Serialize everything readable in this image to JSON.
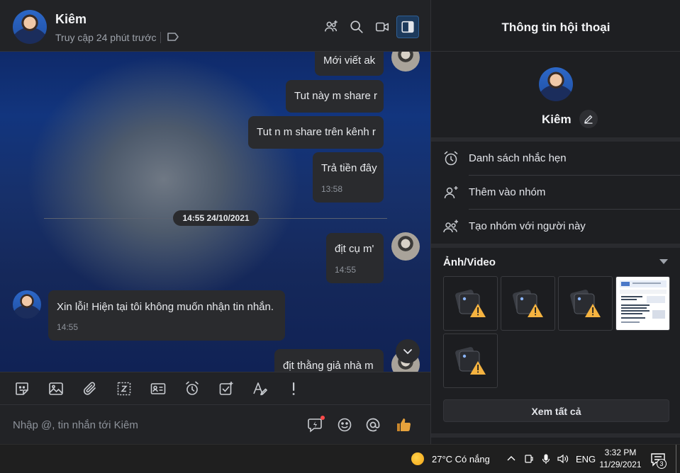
{
  "header": {
    "contact_name": "Kiêm",
    "status": "Truy cập 24 phút trước"
  },
  "messages": {
    "m1": "Mới viết ak",
    "m2": "Tut này m share r",
    "m3": "Tut n m share trên kênh r",
    "m4": "Trả tiền đây",
    "m4_time": "13:58",
    "date_divider": "14:55 24/10/2021",
    "m5": "địt cụ m'",
    "m5_time": "14:55",
    "m6": "Xin lỗi! Hiện tại tôi không muốn nhận tin nhắn.",
    "m6_time": "14:55",
    "m7": "địt thằng giả nhà m"
  },
  "composer": {
    "placeholder": "Nhập @, tin nhắn tới Kiêm"
  },
  "info": {
    "title": "Thông tin hội thoại",
    "name": "Kiêm",
    "rows": [
      {
        "label": "Danh sách nhắc hẹn",
        "icon": "alarm-icon"
      },
      {
        "label": "Thêm vào nhóm",
        "icon": "add-person-icon"
      },
      {
        "label": "Tạo nhóm với người này",
        "icon": "group-add-icon"
      }
    ],
    "media_title": "Ảnh/Video",
    "view_all": "Xem tất cả",
    "doc_preview_lines": [
      "Thông tin đăng ký",
      "Họ tên: ...",
      "Ngày sinh: ...",
      "Số điện thoại",
      "Địa chỉ ...",
      "Ghi chú ..."
    ]
  },
  "taskbar": {
    "weather": "27°C  Có nắng",
    "lang": "ENG",
    "time": "3:32 PM",
    "date": "11/29/2021",
    "notifications": "3"
  },
  "colors": {
    "accent": "#2f5f93",
    "bubble": "#2a2b2e",
    "warning": "#f5b340",
    "like": "#e6a23c"
  }
}
